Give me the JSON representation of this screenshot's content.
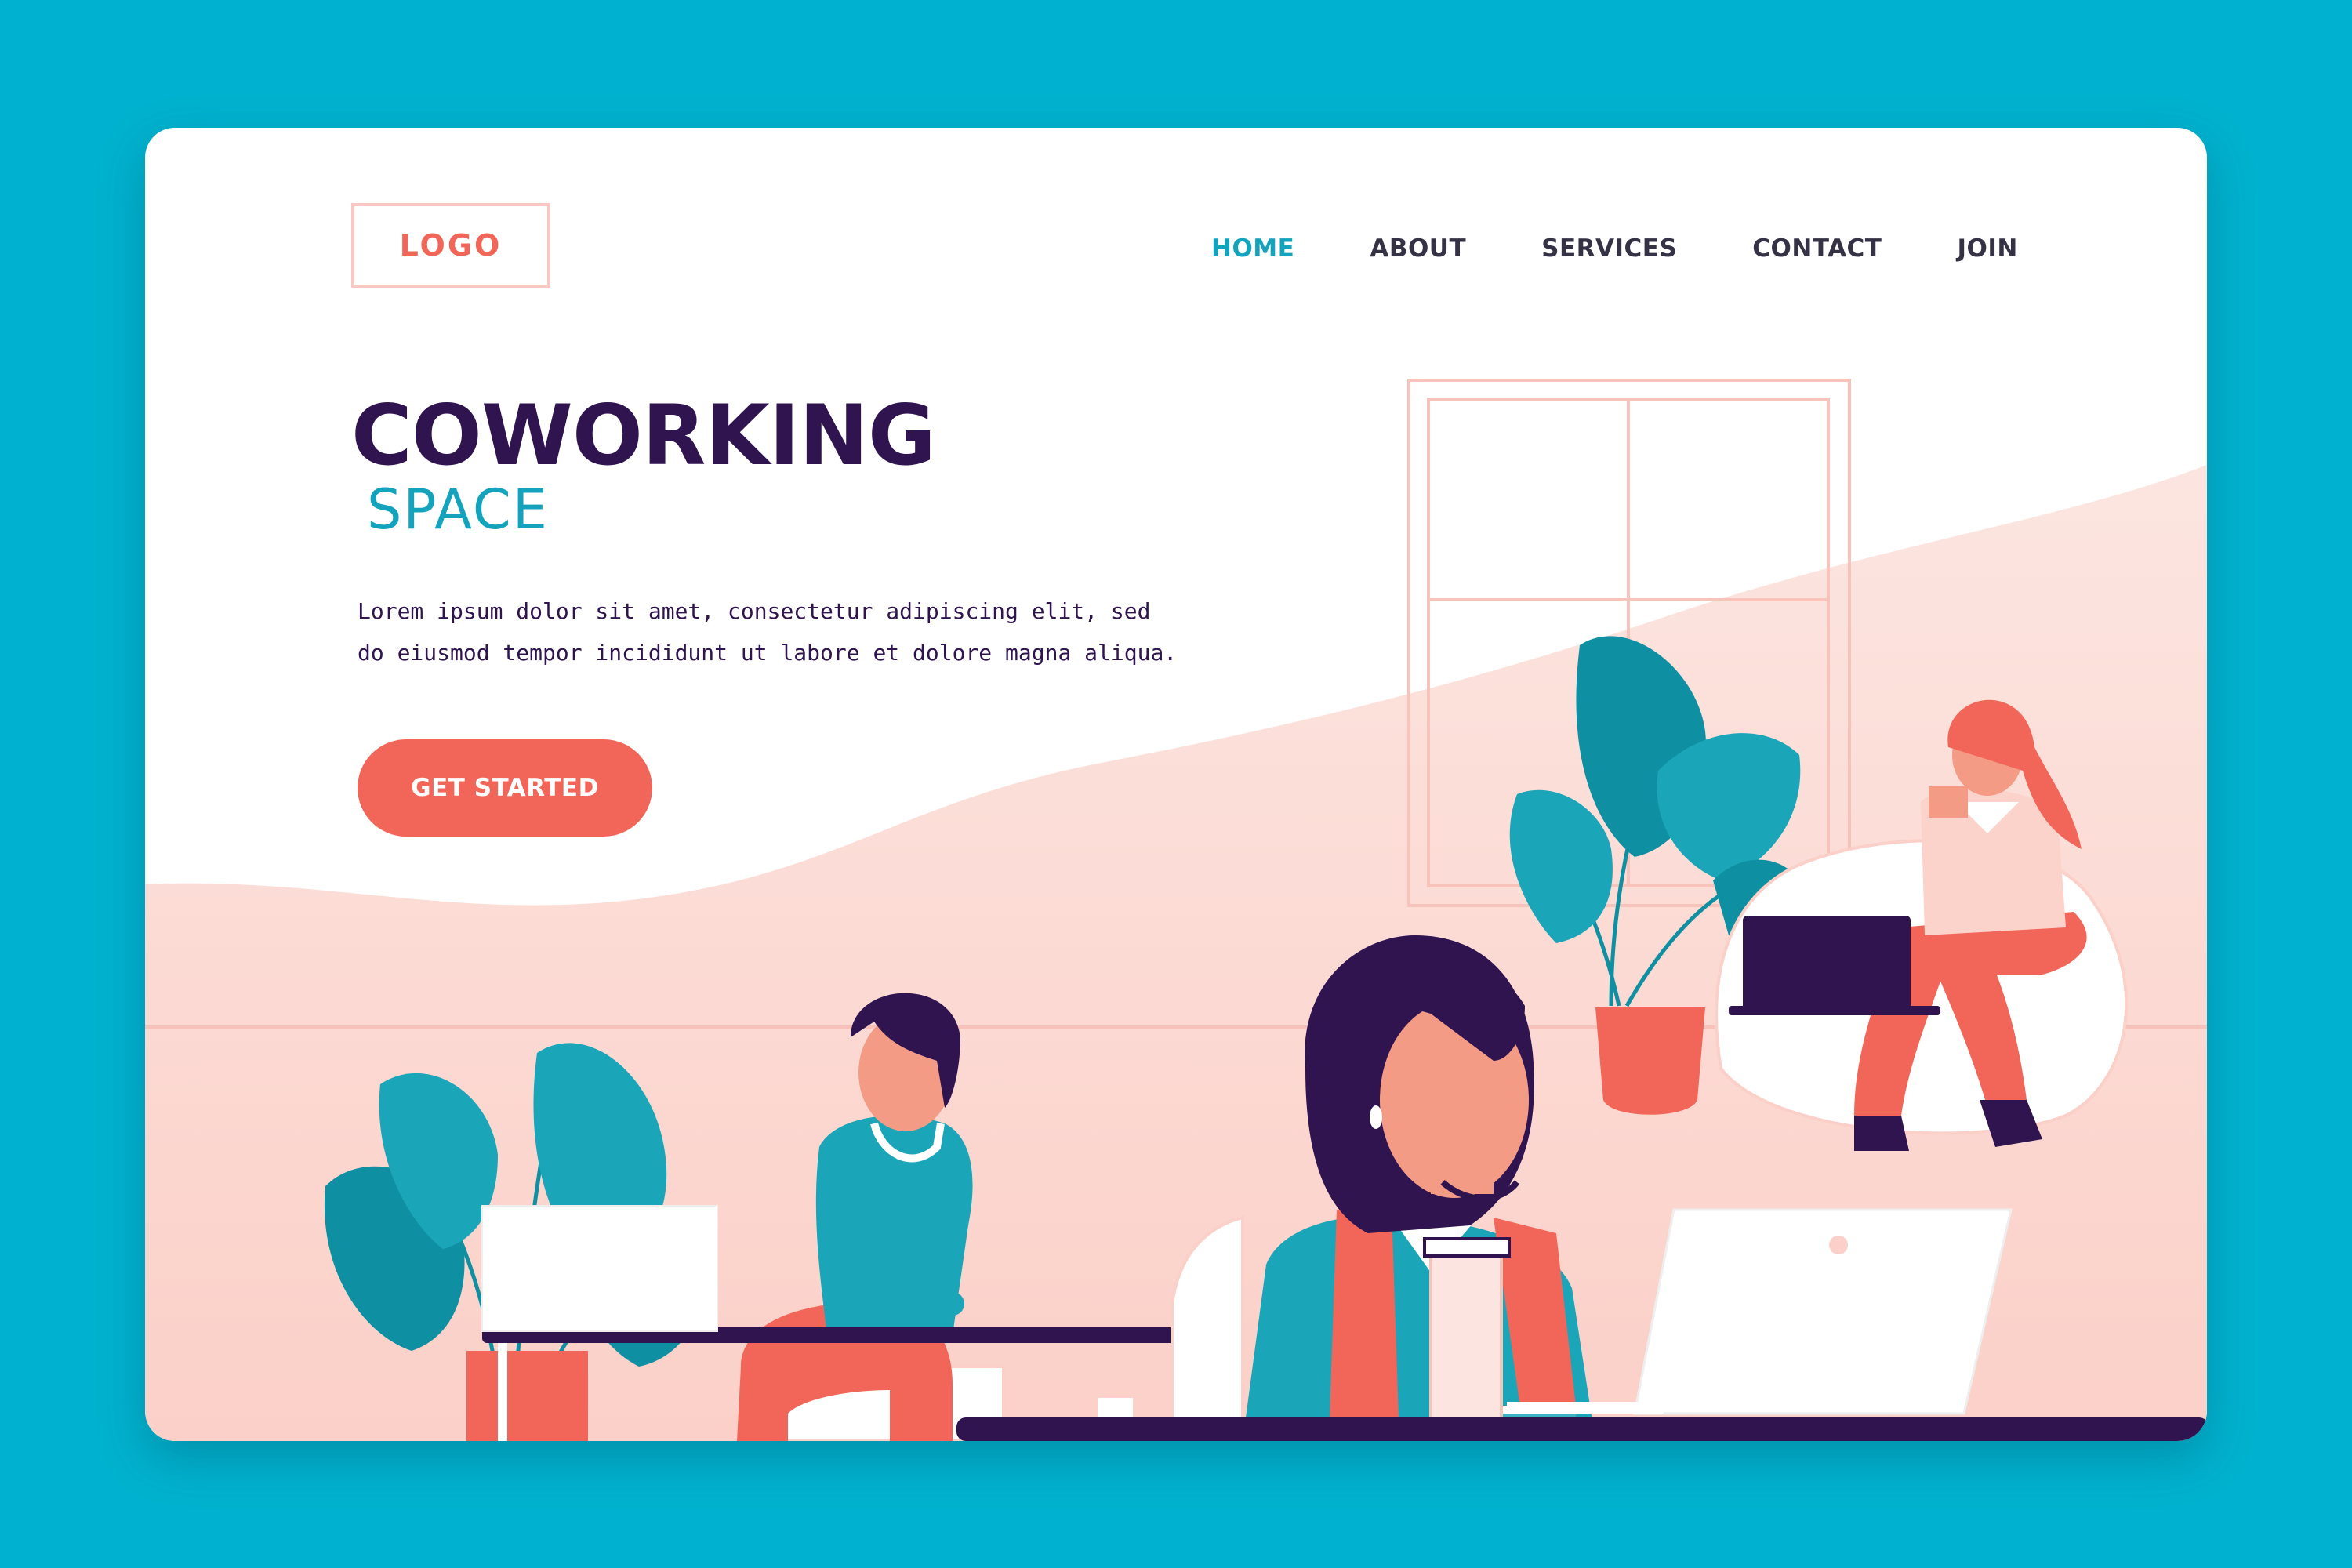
{
  "header": {
    "logo_text": "LOGO",
    "nav": [
      {
        "label": "HOME",
        "active": true
      },
      {
        "label": "ABOUT",
        "active": false
      },
      {
        "label": "SERVICES",
        "active": false
      },
      {
        "label": "CONTACT",
        "active": false
      },
      {
        "label": "JOIN",
        "active": false
      }
    ]
  },
  "hero": {
    "title": "COWORKING",
    "subtitle": "SPACE",
    "description": "Lorem ipsum dolor sit amet, consectetur adipiscing elit, sed do eiusmod tempor incididunt ut labore et dolore magna aliqua.",
    "cta_label": "GET STARTED"
  },
  "colors": {
    "background": "#00b2cf",
    "card": "#ffffff",
    "accent_coral": "#f2665a",
    "accent_teal": "#14a3bd",
    "dark_purple": "#2f1450",
    "pink_wave": "#fbdad4"
  },
  "illustration": {
    "elements": [
      "window-illustration",
      "monstera-plant-illustration",
      "man-with-laptop-illustration",
      "woman-with-laptop-and-coffee-illustration",
      "woman-on-beanbag-illustration",
      "desk-illustration"
    ]
  }
}
